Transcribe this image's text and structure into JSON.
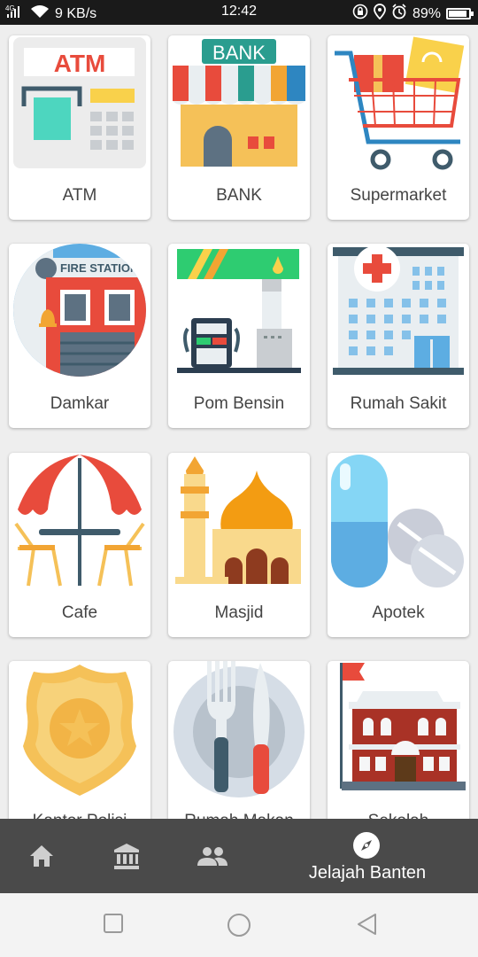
{
  "status_bar": {
    "network": "4G",
    "speed": "9 KB/s",
    "time": "12:42",
    "battery": "89%",
    "battery_level": 0.89
  },
  "grid": {
    "items": [
      {
        "label": "ATM",
        "icon": "atm-icon"
      },
      {
        "label": "BANK",
        "icon": "bank-icon",
        "sign": "BANK"
      },
      {
        "label": "Supermarket",
        "icon": "shopping-cart-icon"
      },
      {
        "label": "Damkar",
        "icon": "fire-station-icon",
        "sign": "FIRE STATION"
      },
      {
        "label": "Pom Bensin",
        "icon": "gas-station-icon"
      },
      {
        "label": "Rumah Sakit",
        "icon": "hospital-icon"
      },
      {
        "label": "Cafe",
        "icon": "cafe-icon"
      },
      {
        "label": "Masjid",
        "icon": "mosque-icon"
      },
      {
        "label": "Apotek",
        "icon": "pills-icon"
      },
      {
        "label": "Kantor Polisi",
        "icon": "police-badge-icon"
      },
      {
        "label": "Rumah Makan",
        "icon": "plate-cutlery-icon"
      },
      {
        "label": "Sekolah",
        "icon": "school-icon"
      }
    ],
    "atm_sign": "ATM"
  },
  "bottom_nav": {
    "items": [
      {
        "icon": "home-icon"
      },
      {
        "icon": "institution-icon"
      },
      {
        "icon": "people-icon"
      }
    ],
    "active": {
      "icon": "compass-icon",
      "label": "Jelajah Banten"
    }
  },
  "system_nav": {
    "buttons": [
      {
        "icon": "recent-apps-icon"
      },
      {
        "icon": "home-circle-icon"
      },
      {
        "icon": "back-triangle-icon"
      }
    ]
  }
}
